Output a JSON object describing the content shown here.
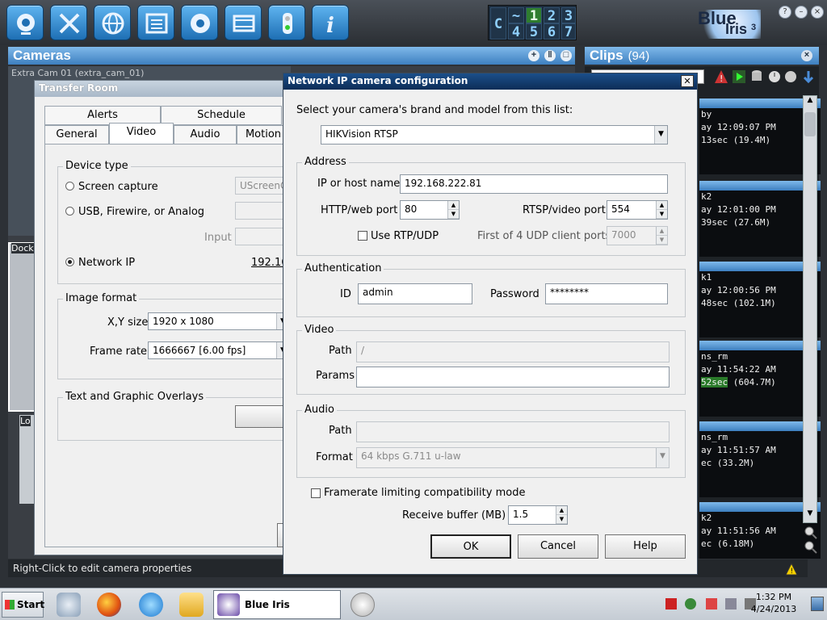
{
  "toolbar": {
    "buttons": [
      "camera-icon",
      "tools-icon",
      "globe-icon",
      "list-icon",
      "aperture-icon",
      "film-icon",
      "traffic-light-icon",
      "info-icon"
    ],
    "profiles": [
      "C",
      "~",
      "1",
      "2",
      "3",
      "4",
      "5",
      "6",
      "7"
    ],
    "active_profile": "1",
    "logo_line1": "Blue",
    "logo_line2": "Iris",
    "logo_sup": "3"
  },
  "cameras": {
    "title": "Cameras",
    "cam_labels": [
      "Extra Cam 01 (extra_cam_01)",
      "Dock",
      "Lo"
    ],
    "status_text": "Right-Click to edit camera properties"
  },
  "clips": {
    "title": "Clips",
    "count": "(94)",
    "items": [
      {
        "l1": "by",
        "l2": "ay 12:09:07 PM",
        "l3": "13sec (19.4M)",
        "hl": false
      },
      {
        "l1": "k2",
        "l2": "ay 12:01:00 PM",
        "l3": "39sec (27.6M)",
        "hl": false
      },
      {
        "l1": "k1",
        "l2": "ay 12:00:56 PM",
        "l3": "48sec (102.1M)",
        "hl": false
      },
      {
        "l1": "ns_rm",
        "l2": "ay 11:54:22 AM",
        "l3_hl": "52sec",
        "l3": " (604.7M)",
        "hl": true
      },
      {
        "l1": "ns_rm",
        "l2": "ay 11:51:57 AM",
        "l3": "ec (33.2M)",
        "hl": false
      },
      {
        "l1": "k2",
        "l2": "ay 11:51:56 AM",
        "l3": "ec (6.18M)",
        "hl": false
      }
    ]
  },
  "transfer_room": {
    "title": "Transfer Room",
    "tabs_row1": [
      "Alerts",
      "Schedule"
    ],
    "tabs_row2": [
      "General",
      "Video",
      "Audio",
      "Motion"
    ],
    "selected_tab": "Video",
    "device_type_title": "Device type",
    "radio_screen": "Screen capture",
    "radio_usb": "USB, Firewire, or Analog",
    "radio_network": "Network IP",
    "screen_field": "UScreenC",
    "input_label": "Input",
    "network_value": "192.16",
    "image_format_title": "Image format",
    "xy_label": "X,Y size",
    "xy_value": "1920 x 1080",
    "framerate_label": "Frame rate",
    "framerate_value": "1666667 [6.00 fps]",
    "overlays_title": "Text and Graphic Overlays"
  },
  "ip_config": {
    "title": "Network IP camera configuration",
    "prompt": "Select your camera's brand and model from this list:",
    "brand_value": "HIKVision RTSP",
    "address_title": "Address",
    "ip_label": "IP or host name",
    "ip_value": "192.168.222.81",
    "http_label": "HTTP/web port",
    "http_value": "80",
    "rtsp_label": "RTSP/video port",
    "rtsp_value": "554",
    "use_rtp_label": "Use RTP/UDP",
    "udp_label": "First of 4 UDP client ports",
    "udp_value": "7000",
    "auth_title": "Authentication",
    "id_label": "ID",
    "id_value": "admin",
    "password_label": "Password",
    "password_value": "********",
    "video_title": "Video",
    "video_path_label": "Path",
    "video_path_value": "/",
    "params_label": "Params",
    "params_value": "",
    "audio_title": "Audio",
    "audio_path_label": "Path",
    "audio_path_value": "",
    "format_label": "Format",
    "format_value": "64 kbps G.711 u-law",
    "framerate_limit_label": "Framerate limiting compatibility mode",
    "receive_buffer_label": "Receive buffer (MB)",
    "receive_buffer_value": "1.5",
    "ok": "OK",
    "cancel": "Cancel",
    "help": "Help"
  },
  "taskbar": {
    "start": "Start",
    "app": "Blue Iris",
    "time": "1:32 PM",
    "date": "4/24/2013"
  }
}
